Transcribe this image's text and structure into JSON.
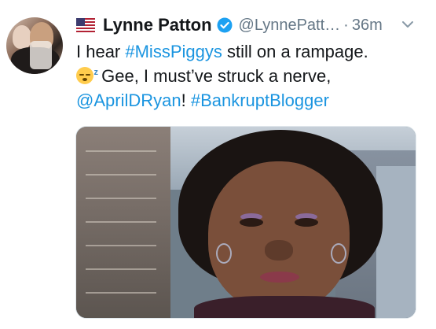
{
  "author": {
    "name": "Lynne Patton",
    "handle": "@LynnePatt…",
    "separator": "·",
    "time": "36m",
    "flag_icon": "us-flag-icon",
    "verified_icon": "verified-badge-icon"
  },
  "tweet": {
    "line1_prefix": "I hear ",
    "line1_hashtag": "#MissPiggys",
    "line1_suffix": " still on a rampage.",
    "line2_emoji": "sleeping-face-emoji",
    "line2_text": " Gee, I must’ve struck a nerve,",
    "line3_mention": "@AprilDRyan",
    "line3_bang": "! ",
    "line3_hashtag": "#BankruptBlogger"
  },
  "colors": {
    "link": "#1b95e0",
    "text": "#14171a",
    "muted": "#657786",
    "verified": "#1da1f2"
  }
}
